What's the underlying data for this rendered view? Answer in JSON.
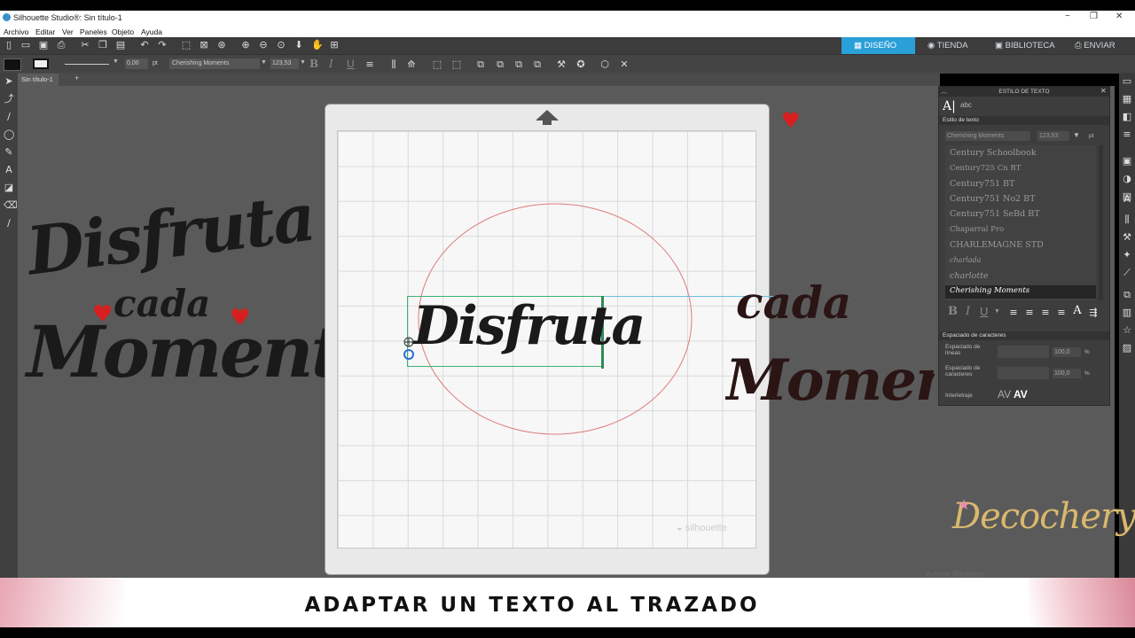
{
  "window": {
    "title": "Silhouette Studio®: Sin título-1",
    "controls": [
      "−",
      "❐",
      "✕"
    ]
  },
  "menu": [
    "Archivo",
    "Editar",
    "Ver",
    "Paneles",
    "Objeto",
    "Ayuda"
  ],
  "nav_tabs": [
    {
      "label": "DISEÑO",
      "icon": "grid-icon",
      "active": true
    },
    {
      "label": "TIENDA",
      "icon": "store-icon",
      "active": false
    },
    {
      "label": "BIBLIOTECA",
      "icon": "library-icon",
      "active": false
    },
    {
      "label": "ENVIAR",
      "icon": "send-icon",
      "active": false
    }
  ],
  "toolbar2": {
    "line_width": "0,00",
    "line_unit": "pt",
    "font_name": "Cherishing Moments",
    "font_size": "123,53",
    "bold": "B",
    "italic": "I",
    "underline": "U"
  },
  "doc_tab": {
    "label": "Sin título-1",
    "add": "+"
  },
  "canvas": {
    "text_selected": "Disfruta",
    "watermark": "silhouette"
  },
  "left_artwork": {
    "line1": "Disfruta",
    "line2": "cada",
    "line3": "Momento"
  },
  "right_artwork": {
    "line1": "cada",
    "line2": "Momento"
  },
  "panel": {
    "title": "ESTILO DE TEXTO",
    "section_style": "Estilo de texto",
    "font_field": "Cherishing Moments",
    "size_field": "123,53",
    "size_unit": "pt",
    "fonts": [
      "Century Schoolbook",
      "Century725 Cn BT",
      "Century751 BT",
      "Century751 No2 BT",
      "Century751 SeBd BT",
      "Chaparral Pro",
      "CHARLEMAGNE STD",
      "charlada",
      "charlotte",
      "Cherishing Moments"
    ],
    "selected_font_index": 9,
    "format_buttons": [
      "B",
      "I",
      "U"
    ],
    "section_spacing": "Espaciado de caracteres",
    "line_spacing_label": "Espaciado de líneas",
    "line_spacing_value": "100,0",
    "char_spacing_label": "Espaciado de caracteres",
    "char_spacing_value": "100,0",
    "percent": "%",
    "kerning_label": "Interletraje",
    "kerning_buttons": [
      "AV",
      "AV"
    ]
  },
  "branding": {
    "logo": "Decochery",
    "faint_text": "Activar Windows"
  },
  "caption": "ADAPTAR UN TEXTO AL TRAZADO",
  "colors": {
    "accent": "#2aa0d8",
    "heart": "#d81e1e",
    "path_circle": "#e07a7a",
    "selection": "#3cb371"
  }
}
